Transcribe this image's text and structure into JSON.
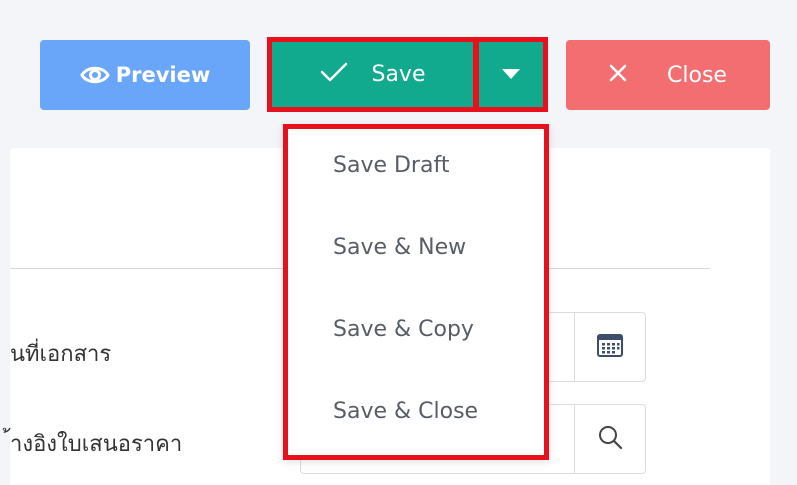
{
  "toolbar": {
    "preview_label": "Preview",
    "save_label": "Save",
    "close_label": "Close"
  },
  "save_menu": {
    "items": [
      "Save Draft",
      "Save & New",
      "Save & Copy",
      "Save & Close"
    ]
  },
  "form": {
    "field_1_label": "นที่เอกสาร",
    "field_2_label": "้างอิงใบเสนอราคา"
  },
  "icons": {
    "preview": "eye-icon",
    "save": "check-icon",
    "save_menu": "caret-down-icon",
    "close": "close-icon",
    "field_1_addon": "calendar-icon",
    "field_2_addon": "search-icon"
  },
  "colors": {
    "preview_button": "#69a6f9",
    "save_button": "#12aa8e",
    "close_button": "#f26e71",
    "highlight": "#e8101a"
  }
}
